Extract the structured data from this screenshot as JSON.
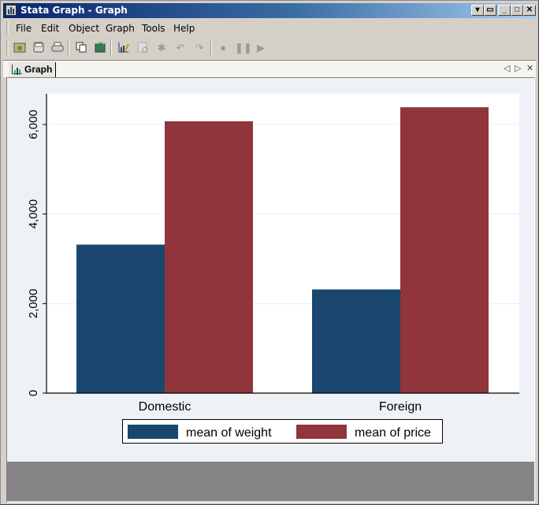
{
  "window": {
    "title": "Stata Graph - Graph",
    "controls": [
      "menu",
      "restore-docked",
      "minimize",
      "maximize",
      "close"
    ]
  },
  "menubar": {
    "items": [
      {
        "label": "File",
        "mnemonic": "F"
      },
      {
        "label": "Edit",
        "mnemonic": "E"
      },
      {
        "label": "Object",
        "mnemonic": "O"
      },
      {
        "label": "Graph",
        "mnemonic": "G"
      },
      {
        "label": "Tools",
        "mnemonic": "T"
      },
      {
        "label": "Help",
        "mnemonic": "H"
      }
    ]
  },
  "toolbar": {
    "buttons": [
      {
        "name": "open-graph",
        "icon": "folder-open-icon",
        "enabled": true
      },
      {
        "name": "save-graph",
        "icon": "floppy-disk-icon",
        "enabled": true
      },
      {
        "name": "print-graph",
        "icon": "printer-icon",
        "enabled": true
      },
      {
        "name": "copy-graph",
        "icon": "copy-icon",
        "enabled": true
      },
      {
        "name": "rename-graph",
        "icon": "rename-icon",
        "enabled": true
      },
      {
        "name": "graph-editor",
        "icon": "chart-edit-icon",
        "enabled": true
      },
      {
        "name": "object-browser",
        "icon": "object-browser-icon",
        "enabled": false
      },
      {
        "name": "pointer",
        "icon": "pointer-icon",
        "enabled": false
      },
      {
        "name": "undo",
        "icon": "undo-icon",
        "enabled": false
      },
      {
        "name": "redo",
        "icon": "redo-icon",
        "enabled": false
      },
      {
        "name": "record",
        "icon": "record-icon",
        "enabled": false
      },
      {
        "name": "pause",
        "icon": "pause-icon",
        "enabled": false
      },
      {
        "name": "play",
        "icon": "play-icon",
        "enabled": false
      }
    ]
  },
  "tabs": [
    {
      "label": "Graph",
      "active": true
    }
  ],
  "colors": {
    "series1": "#1a476f",
    "series2": "#90353b",
    "plot_bg": "#ffffff",
    "graph_bg": "#eef2f7",
    "grid": "#eaeef3"
  },
  "chart_data": {
    "type": "bar",
    "title": "",
    "xlabel": "",
    "ylabel": "",
    "categories": [
      "Domestic",
      "Foreign"
    ],
    "series": [
      {
        "name": "mean of weight",
        "values": [
          3317,
          2316
        ]
      },
      {
        "name": "mean of price",
        "values": [
          6072,
          6385
        ]
      }
    ],
    "ylim": [
      0,
      6700
    ],
    "yticks": [
      0,
      2000,
      4000,
      6000
    ],
    "ytick_labels": [
      "0",
      "2,000",
      "4,000",
      "6,000"
    ],
    "grid": true,
    "legend": {
      "position": "bottom",
      "entries": [
        "mean of weight",
        "mean of price"
      ]
    }
  }
}
